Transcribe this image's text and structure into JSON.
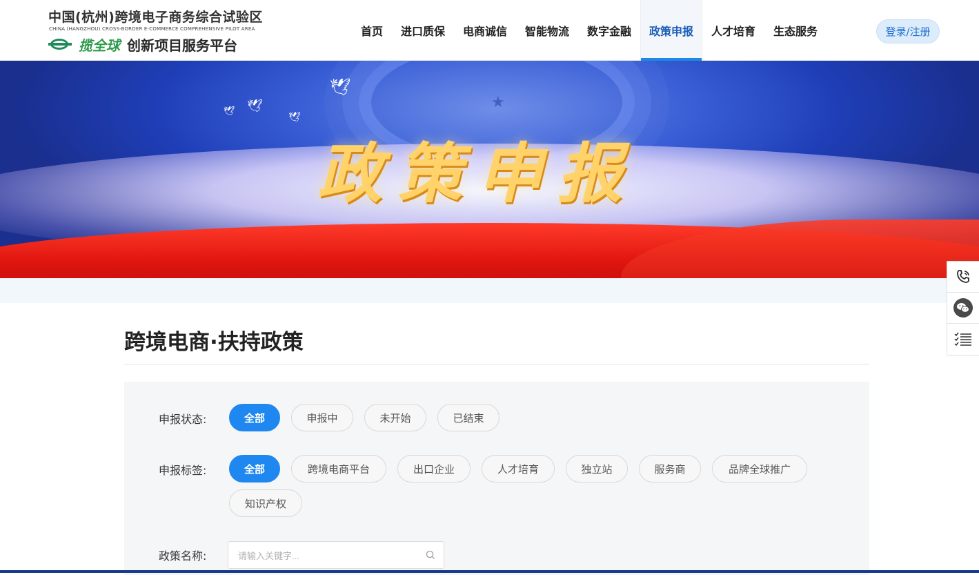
{
  "header": {
    "logo_cn": "中国(杭州)跨境电子商务综合试验区",
    "logo_en": "CHINA (HANGZHOU) CROSS-BORDER E-COMMERCE COMPREHENSIVE PILOT AREA",
    "logo_brand": "揽全球",
    "logo_subtitle": "创新项目服务平台",
    "nav": [
      {
        "label": "首页"
      },
      {
        "label": "进口质保"
      },
      {
        "label": "电商诚信"
      },
      {
        "label": "智能物流"
      },
      {
        "label": "数字金融"
      },
      {
        "label": "政策申报"
      },
      {
        "label": "人才培育"
      },
      {
        "label": "生态服务"
      }
    ],
    "active_nav": "政策申报",
    "login_label": "登录/注册"
  },
  "banner": {
    "title": "政策申报"
  },
  "main": {
    "section_title": "跨境电商·扶持政策",
    "filters": {
      "status_label": "申报状态:",
      "status_options": [
        "全部",
        "申报中",
        "未开始",
        "已结束"
      ],
      "status_selected": "全部",
      "tag_label": "申报标签:",
      "tag_options": [
        "全部",
        "跨境电商平台",
        "出口企业",
        "人才培育",
        "独立站",
        "服务商",
        "品牌全球推广",
        "知识产权"
      ],
      "tag_selected": "全部",
      "name_label": "政策名称:",
      "search_placeholder": "请输入关键字..."
    }
  },
  "side_tools": [
    "phone-icon",
    "wechat-icon",
    "list-icon"
  ],
  "colors": {
    "accent": "#1e88f0",
    "nav_active": "#1d5fb8",
    "banner_red": "#e0150f",
    "banner_blue": "#2a4fc8"
  }
}
